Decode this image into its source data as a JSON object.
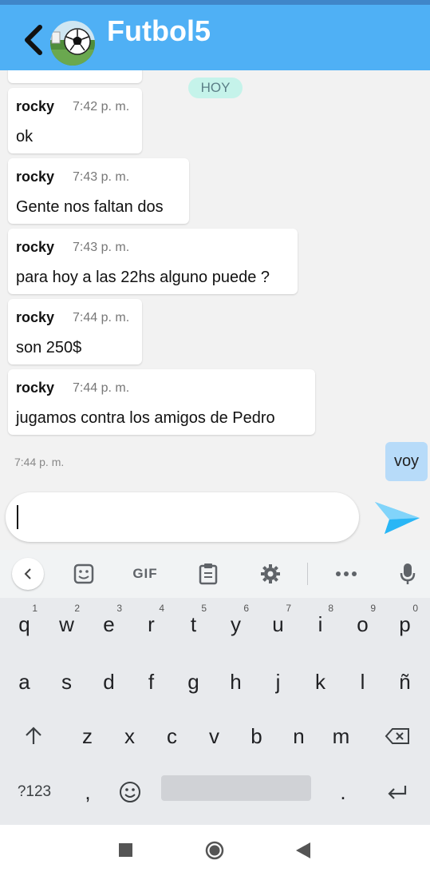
{
  "app": {
    "title": "Futbol5"
  },
  "chat": {
    "day_badge": "HOY",
    "messages": [
      {
        "sender": "rocky",
        "time": "7:42 p. m.",
        "text": "ok"
      },
      {
        "sender": "rocky",
        "time": "7:43 p. m.",
        "text": "Gente nos faltan dos"
      },
      {
        "sender": "rocky",
        "time": "7:43 p. m.",
        "text": "para hoy a las 22hs alguno puede ?"
      },
      {
        "sender": "rocky",
        "time": "7:44 p. m.",
        "text": "son 250$"
      },
      {
        "sender": "rocky",
        "time": "7:44 p. m.",
        "text": "jugamos contra los amigos de Pedro"
      }
    ],
    "sent": {
      "time": "7:44 p. m.",
      "text": "voy"
    }
  },
  "composer": {
    "value": ""
  },
  "keyboard": {
    "suggestion_bar": {
      "gif_label": "GIF"
    },
    "row1": [
      {
        "key": "q",
        "num": "1"
      },
      {
        "key": "w",
        "num": "2"
      },
      {
        "key": "e",
        "num": "3"
      },
      {
        "key": "r",
        "num": "4"
      },
      {
        "key": "t",
        "num": "5"
      },
      {
        "key": "y",
        "num": "6"
      },
      {
        "key": "u",
        "num": "7"
      },
      {
        "key": "i",
        "num": "8"
      },
      {
        "key": "o",
        "num": "9"
      },
      {
        "key": "p",
        "num": "0"
      }
    ],
    "row2": [
      "a",
      "s",
      "d",
      "f",
      "g",
      "h",
      "j",
      "k",
      "l",
      "ñ"
    ],
    "row3": [
      "z",
      "x",
      "c",
      "v",
      "b",
      "n",
      "m"
    ],
    "row4": {
      "symbols": "?123",
      "comma": ",",
      "period": "."
    }
  },
  "colors": {
    "appbar": "#4fb0f5",
    "sent_bubble": "#b7dbf9",
    "day_badge": "#c5f3ea"
  },
  "icons": [
    "back-arrow-icon",
    "send-icon",
    "sticker-icon",
    "clipboard-icon",
    "settings-icon",
    "more-icon",
    "mic-icon",
    "shift-icon",
    "backspace-icon",
    "emoji-icon",
    "enter-icon",
    "recents-icon",
    "home-icon",
    "back-nav-icon"
  ]
}
